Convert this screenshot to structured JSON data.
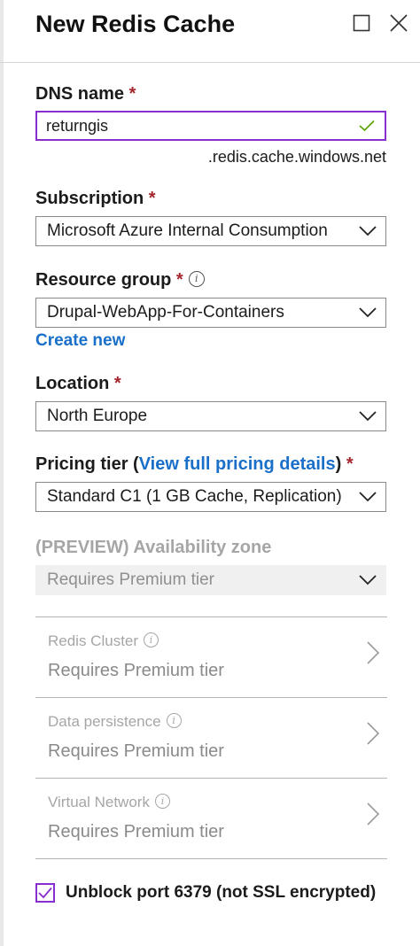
{
  "header": {
    "title": "New Redis Cache"
  },
  "dns": {
    "label": "DNS name",
    "required": "*",
    "value": "returngis",
    "suffix": ".redis.cache.windows.net"
  },
  "subscription": {
    "label": "Subscription",
    "required": "*",
    "selected": "Microsoft Azure Internal Consumption"
  },
  "resource_group": {
    "label": "Resource group",
    "required": "*",
    "selected": "Drupal-WebApp-For-Containers",
    "create_new": "Create new"
  },
  "location": {
    "label": "Location",
    "required": "*",
    "selected": "North Europe"
  },
  "pricing": {
    "label_prefix": "Pricing tier (",
    "link": "View full pricing details",
    "label_suffix": ")",
    "required": "*",
    "selected": "Standard C1 (1 GB Cache, Replication)"
  },
  "availability_zone": {
    "label": "(PREVIEW) Availability zone",
    "selected": "Requires Premium tier"
  },
  "sections": [
    {
      "label": "Redis Cluster",
      "value": "Requires Premium tier"
    },
    {
      "label": "Data persistence",
      "value": "Requires Premium tier"
    },
    {
      "label": "Virtual Network",
      "value": "Requires Premium tier"
    }
  ],
  "unblock_port": {
    "label": "Unblock port 6379 (not SSL encrypted)",
    "checked": true
  },
  "colors": {
    "accent": "#8a2fcf",
    "link": "#1a6fc9",
    "required": "#a4262c",
    "valid": "#57a300"
  }
}
